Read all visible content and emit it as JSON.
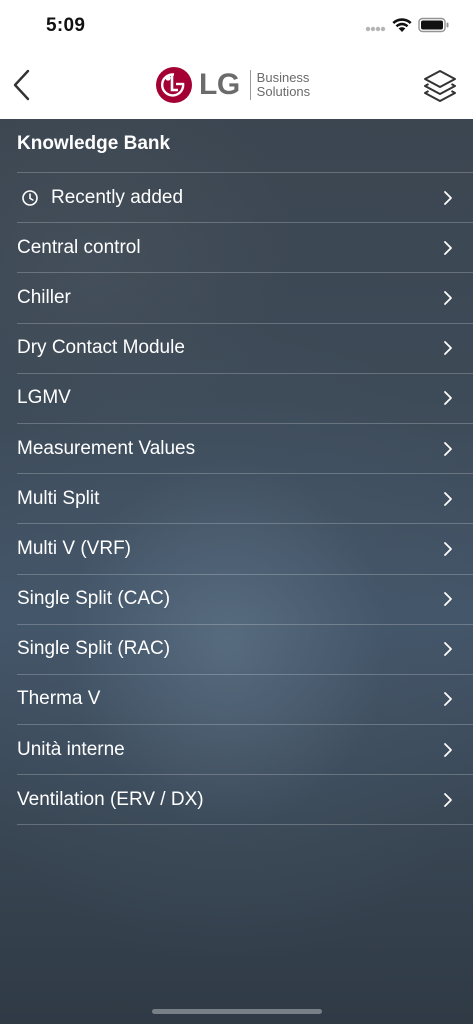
{
  "status_bar": {
    "time": "5:09"
  },
  "nav": {
    "logo": {
      "brand": "LG",
      "sub_line1": "Business",
      "sub_line2": "Solutions"
    }
  },
  "icons": {
    "back": "chevron-left-icon",
    "layers": "layers-icon",
    "clock": "clock-icon",
    "chevron": "chevron-right-icon"
  },
  "colors": {
    "lg_red": "#a50034",
    "text_on_dark": "#ffffff",
    "logo_gray": "#6b6b6b"
  },
  "section": {
    "title": "Knowledge Bank"
  },
  "menu": {
    "items": [
      {
        "label": "Recently added",
        "icon": "clock-icon"
      },
      {
        "label": "Central control"
      },
      {
        "label": "Chiller"
      },
      {
        "label": "Dry Contact Module"
      },
      {
        "label": "LGMV"
      },
      {
        "label": "Measurement Values"
      },
      {
        "label": "Multi Split"
      },
      {
        "label": "Multi V (VRF)"
      },
      {
        "label": "Single Split (CAC)"
      },
      {
        "label": "Single Split (RAC)"
      },
      {
        "label": "Therma V"
      },
      {
        "label": "Unità interne"
      },
      {
        "label": "Ventilation (ERV / DX)"
      }
    ]
  }
}
